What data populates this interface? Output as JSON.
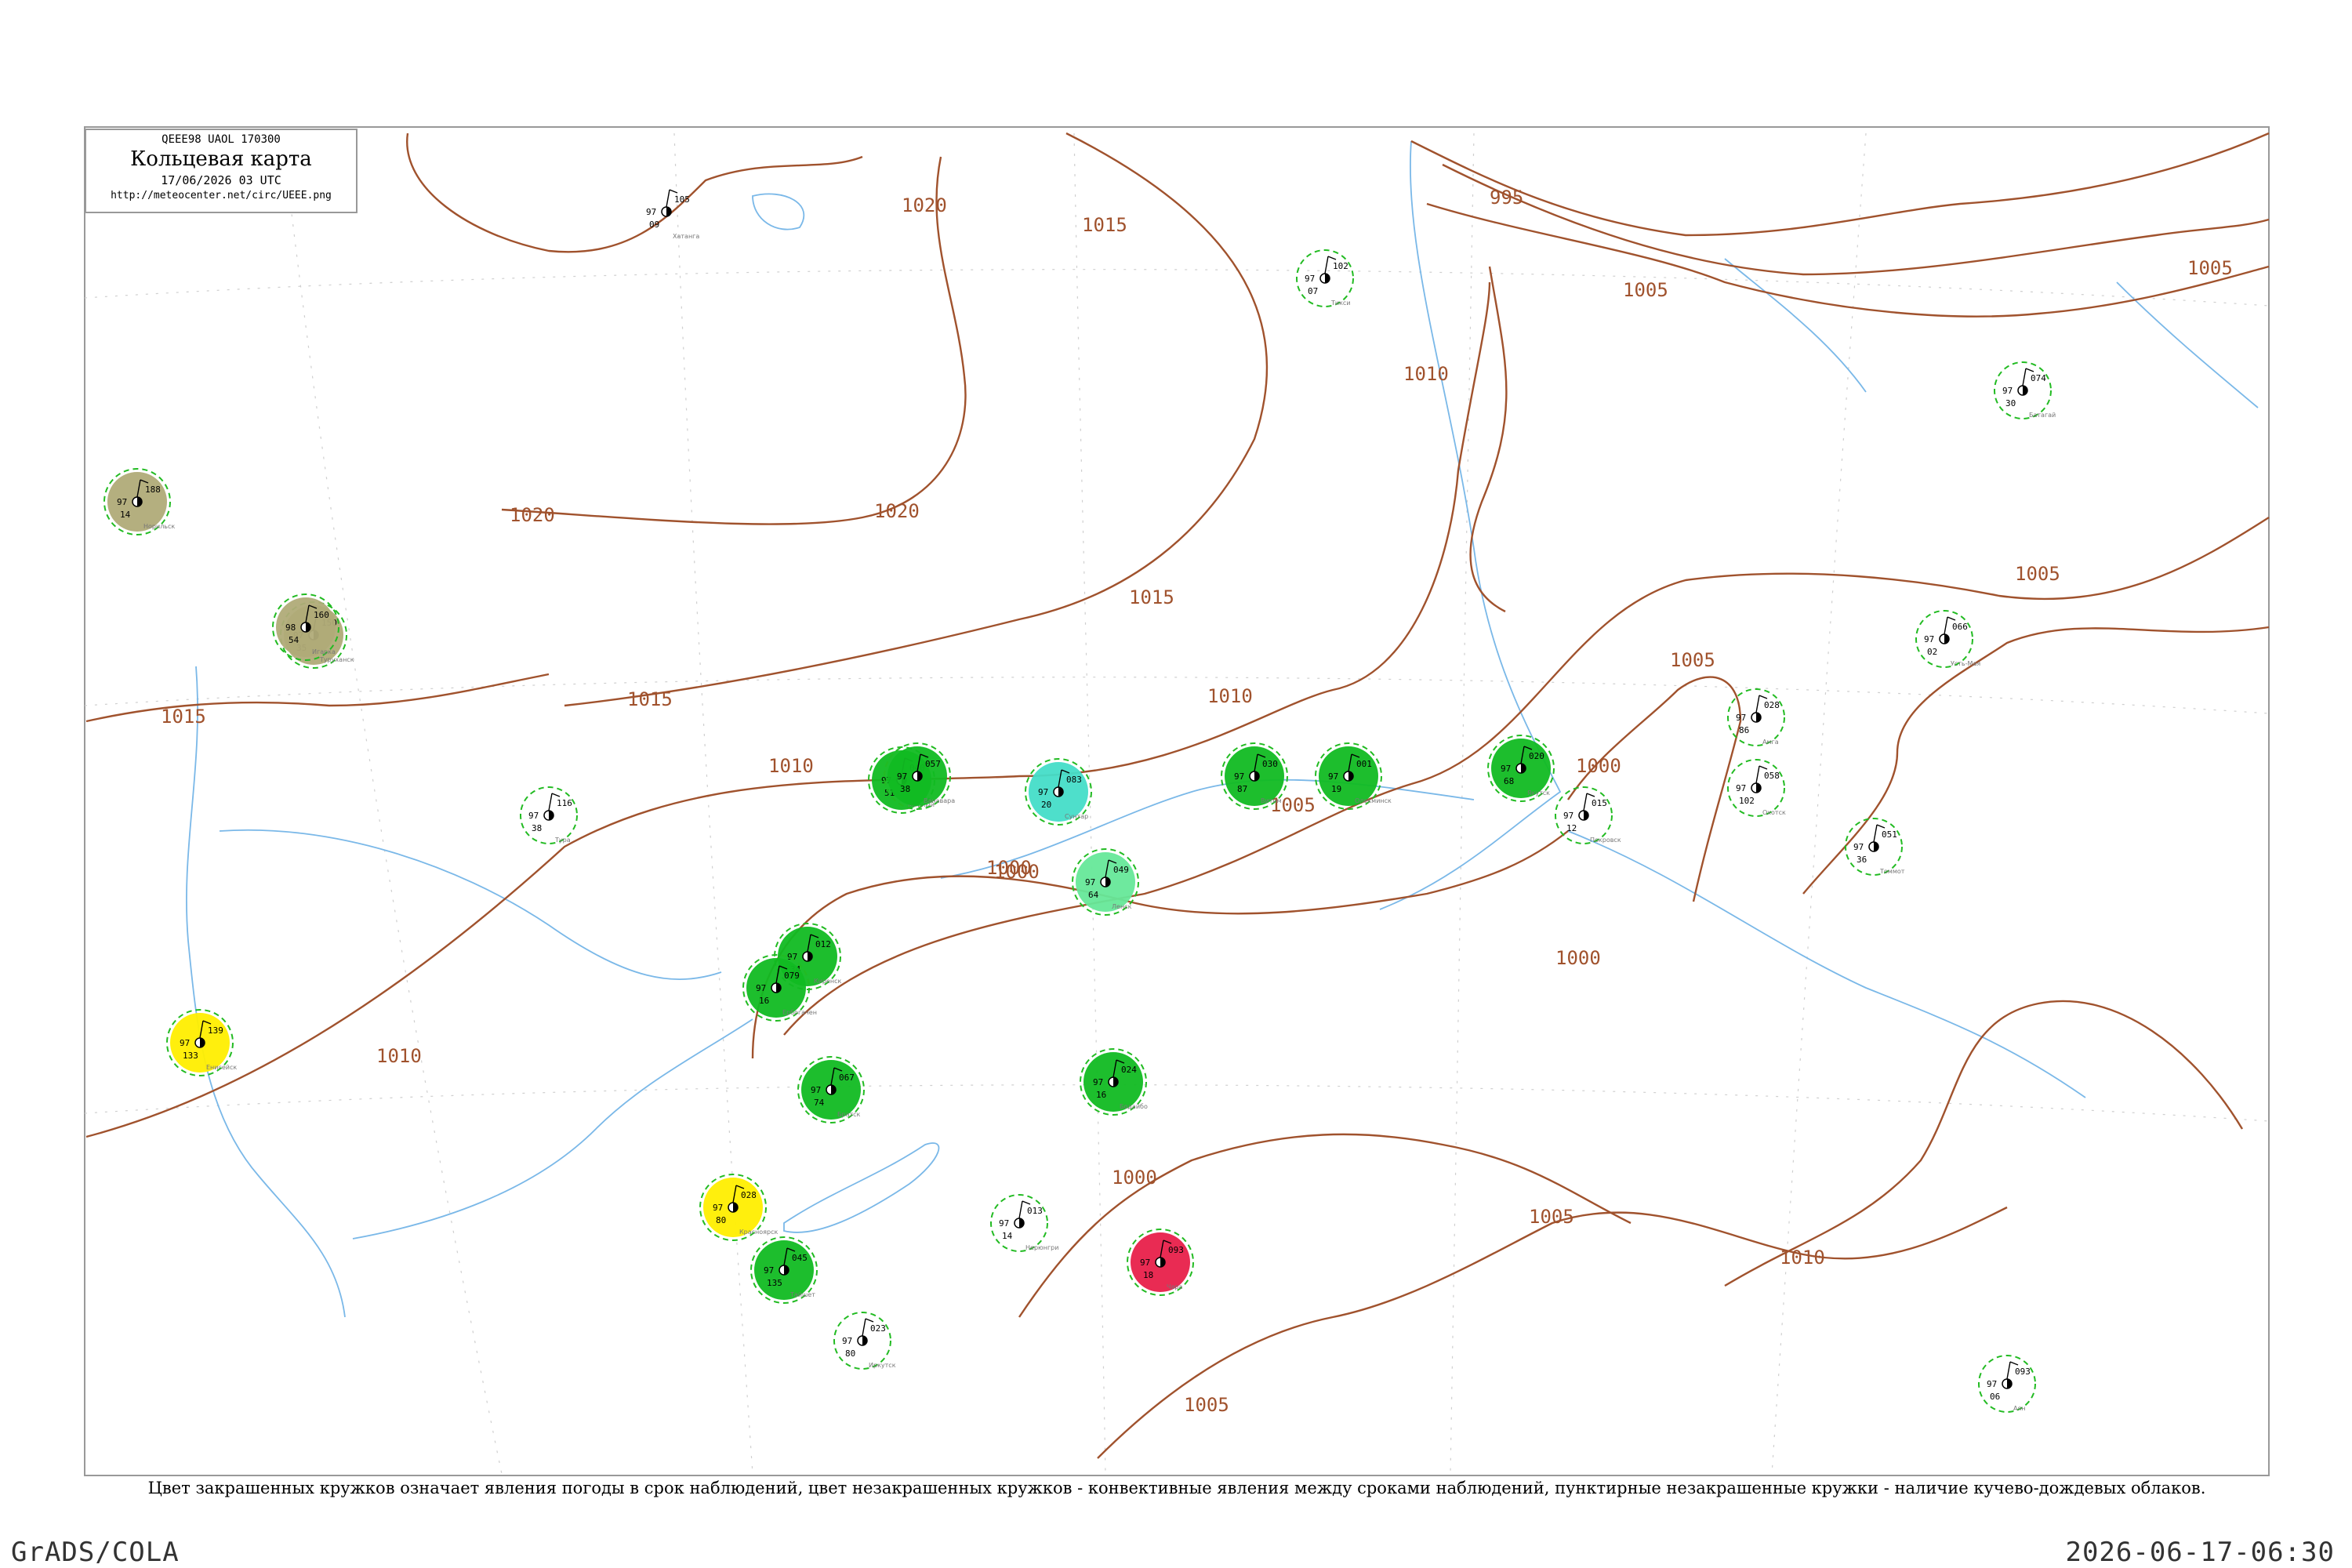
{
  "title": {
    "code": "QEEE98 UAOL 170300",
    "name": "Кольцевая карта",
    "datetime": "17/06/2026 03 UTC",
    "url": "http://meteocenter.net/circ/UEEE.png"
  },
  "caption": "Цвет закрашенных кружков означает явления погоды в срок наблюдений, цвет незакрашенных кружков - конвективные явления между сроками наблюдений, пунктирные незакрашенные кружки - наличие кучево-дождевых облаков.",
  "footer": {
    "left": "GrADS/COLA",
    "right": "2026-06-17-06:30"
  },
  "colors": {
    "isobar": "#a0522d",
    "river": "#7ab8e8",
    "rain": "#11bb22",
    "cb_ring": "#22bb22",
    "fog_haze": "#b0ab78",
    "shower_ts": "#ffee00",
    "drizzle": "#44ddc8",
    "light_rain": "#66e899",
    "thunderstorm": "#e8204a"
  },
  "isobar_labels": [
    "995",
    "1000",
    "1000",
    "1000",
    "1005",
    "1005",
    "1005",
    "1005",
    "1005",
    "1005",
    "1005",
    "1010",
    "1010",
    "1010",
    "1010",
    "1010",
    "1015",
    "1015",
    "1015",
    "1015",
    "1020",
    "1020",
    "1020",
    "1000",
    "1000"
  ],
  "stations": [
    {
      "name": "Тикси",
      "p": "102",
      "t": "97",
      "td": "07",
      "ring": "cb_ring"
    },
    {
      "name": "Батагай",
      "p": "074",
      "t": "97",
      "td": "30",
      "ring": "cb_ring"
    },
    {
      "name": "Усть-Мая",
      "p": "066",
      "t": "97",
      "td": "02",
      "ring": "cb_ring"
    },
    {
      "name": "Амга",
      "p": "028",
      "t": "97",
      "td": "86",
      "ring": "cb_ring"
    },
    {
      "name": "Охотск",
      "p": "058",
      "t": "97",
      "td": "102",
      "ring": "cb_ring"
    },
    {
      "name": "Аян",
      "p": "093",
      "t": "97",
      "td": "06",
      "ring": "cb_ring"
    },
    {
      "name": "Томмот",
      "p": "051",
      "t": "97",
      "td": "36",
      "ring": "cb_ring"
    },
    {
      "name": "Якутск",
      "p": "020",
      "t": "97",
      "td": "68",
      "ring": "rain"
    },
    {
      "name": "Покровск",
      "p": "015",
      "t": "97",
      "td": "12",
      "ring": "cb_ring"
    },
    {
      "name": "Олекминск",
      "p": "001",
      "t": "97",
      "td": "19",
      "ring": "rain"
    },
    {
      "name": "Витим",
      "p": "030",
      "t": "97",
      "td": "87",
      "ring": "rain"
    },
    {
      "name": "Мирный",
      "p": "040",
      "t": "97",
      "td": "51",
      "ring": "rain"
    },
    {
      "name": "Сунтар",
      "p": "083",
      "t": "97",
      "td": "20",
      "ring": "drizzle"
    },
    {
      "name": "Ленск",
      "p": "049",
      "t": "97",
      "td": "64",
      "ring": "light_rain"
    },
    {
      "name": "Туруханск",
      "p": "150",
      "t": "97",
      "td": "35",
      "ring": "fog_haze"
    },
    {
      "name": "Енисейск",
      "p": "139",
      "t": "97",
      "td": "133",
      "ring": "shower_ts"
    },
    {
      "name": "Красноярск",
      "p": "028",
      "t": "97",
      "td": "80",
      "ring": "shower_ts"
    },
    {
      "name": "Чара",
      "p": "093",
      "t": "97",
      "td": "18",
      "ring": "thunderstorm"
    },
    {
      "name": "Бодайбо",
      "p": "024",
      "t": "97",
      "td": "16",
      "ring": "rain"
    },
    {
      "name": "Киренск",
      "p": "012",
      "t": "97",
      "td": "34",
      "ring": "rain"
    },
    {
      "name": "Братск",
      "p": "067",
      "t": "97",
      "td": "74",
      "ring": "rain"
    },
    {
      "name": "Тайшет",
      "p": "045",
      "t": "97",
      "td": "135",
      "ring": "rain"
    },
    {
      "name": "Иркутск",
      "p": "023",
      "t": "97",
      "td": "80",
      "ring": "cb_ring"
    },
    {
      "name": "Ванавара",
      "p": "057",
      "t": "97",
      "td": "38",
      "ring": "rain"
    },
    {
      "name": "Тура",
      "p": "116",
      "t": "97",
      "td": "38",
      "ring": "cb_ring"
    },
    {
      "name": "Ербогачен",
      "p": "079",
      "t": "97",
      "td": "16",
      "ring": "rain"
    },
    {
      "name": "Хатанга",
      "p": "105",
      "t": "97",
      "td": "09",
      "ring": "none"
    },
    {
      "name": "Норильск",
      "p": "188",
      "t": "97",
      "td": "14",
      "ring": "fog_haze"
    },
    {
      "name": "Игарка",
      "p": "160",
      "t": "98",
      "td": "54",
      "ring": "fog_haze"
    },
    {
      "name": "Нерюнгри",
      "p": "013",
      "t": "97",
      "td": "14",
      "ring": "cb_ring"
    }
  ]
}
